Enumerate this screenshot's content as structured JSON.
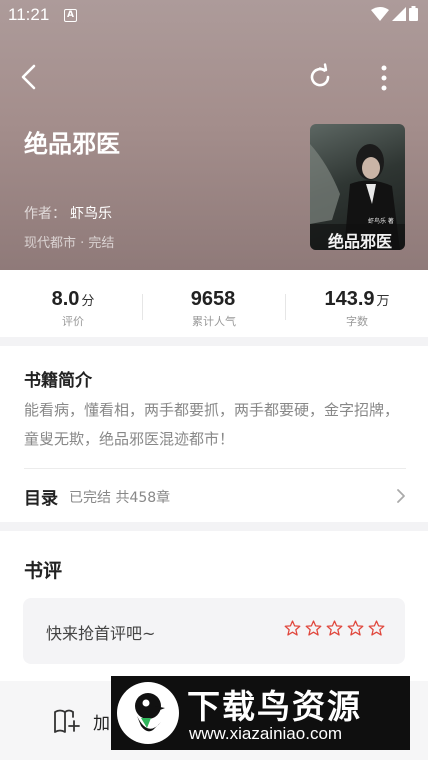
{
  "status_bar": {
    "time": "11:21",
    "notification_glyph": "A"
  },
  "header": {
    "icons": [
      "back-icon",
      "refresh-icon",
      "more-vertical-icon"
    ]
  },
  "book": {
    "title": "绝品邪医",
    "author_label": "作者：",
    "author": "虾鸟乐",
    "genre": "现代都市 · 完结",
    "cover_title": "绝品邪医",
    "cover_author": "虾鸟乐 著"
  },
  "stats": [
    {
      "value": "8.0",
      "unit": "分",
      "label": "评价"
    },
    {
      "value": "9658",
      "unit": "",
      "label": "累计人气"
    },
    {
      "value": "143.9",
      "unit": "万",
      "label": "字数"
    }
  ],
  "intro": {
    "title": "书籍简介",
    "text": "能看病，懂看相，两手都要抓，两手都要硬，金字招牌，童叟无欺，绝品邪医混迹都市！"
  },
  "toc": {
    "label": "目录",
    "status": "已完结 共458章"
  },
  "review": {
    "title": "书评",
    "prompt": "快来抢首评吧~",
    "stars": 5
  },
  "bottom": {
    "add_label": "加"
  },
  "watermark": {
    "title": "下载鸟资源",
    "url": "www.xiazainiao.com"
  },
  "colors": {
    "hero": "#a48e8c",
    "star": "#e0463c",
    "background": "#f3f3f5"
  }
}
